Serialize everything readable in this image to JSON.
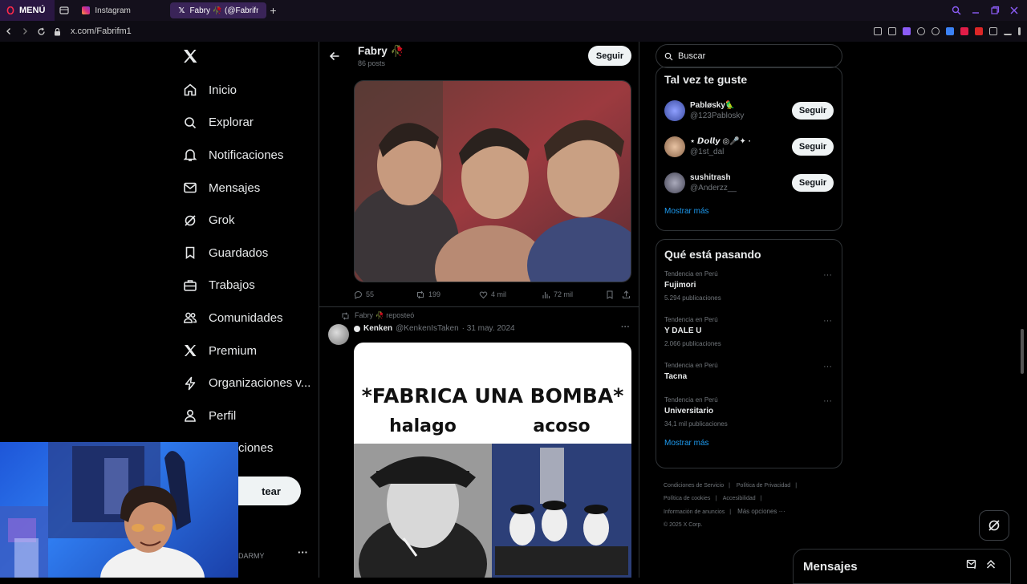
{
  "browser": {
    "menu_label": "MENÚ",
    "tabs": [
      {
        "label": "Instagram",
        "active": false
      },
      {
        "label": "Fabry 🥀 (@Fabrifm1) / X",
        "active": true
      }
    ],
    "url": "x.com/Fabrifm1"
  },
  "nav": {
    "items": [
      {
        "label": "Inicio",
        "icon": "home-icon"
      },
      {
        "label": "Explorar",
        "icon": "search-icon"
      },
      {
        "label": "Notificaciones",
        "icon": "bell-icon"
      },
      {
        "label": "Mensajes",
        "icon": "mail-icon"
      },
      {
        "label": "Grok",
        "icon": "grok-icon"
      },
      {
        "label": "Guardados",
        "icon": "bookmark-icon"
      },
      {
        "label": "Trabajos",
        "icon": "briefcase-icon"
      },
      {
        "label": "Comunidades",
        "icon": "people-icon"
      },
      {
        "label": "Premium",
        "icon": "x-logo-icon"
      },
      {
        "label": "Organizaciones v...",
        "icon": "lightning-icon"
      },
      {
        "label": "Perfil",
        "icon": "person-icon"
      },
      {
        "label": "ciones",
        "icon": "more-icon"
      }
    ],
    "post_label": "tear",
    "account_tail": "DARMY"
  },
  "profile_header": {
    "name": "Fabry 🥀",
    "posts": "86 posts",
    "follow_label": "Seguir"
  },
  "tweet1": {
    "metrics": {
      "replies": "55",
      "retweets": "199",
      "likes": "4 mil",
      "views": "72 mil"
    }
  },
  "tweet2": {
    "reposted_by": "Fabry 🥀 reposteó",
    "author_name": "Kenken",
    "author_handle": "@KenkenIsTaken",
    "date": "· 31 may. 2024",
    "meme_title": "*FABRICA UNA BOMBA*",
    "meme_left": "halago",
    "meme_right": "acoso"
  },
  "search": {
    "placeholder": "Buscar"
  },
  "suggestions": {
    "title": "Tal vez te guste",
    "users": [
      {
        "name": "Pabløsky🦜",
        "handle": "@123Pablosky",
        "button": "Seguir",
        "avatar_color": "#5b6db5"
      },
      {
        "name": "⋆ 𝘿𝙤𝙡𝙡𝙮 ◎🎤✦ ·",
        "handle": "@1st_dal",
        "button": "Seguir",
        "avatar_color": "#b08a6a"
      },
      {
        "name": "sushitrash",
        "handle": "@Anderzz__",
        "button": "Seguir",
        "avatar_color": "#555a66"
      }
    ],
    "more": "Mostrar más"
  },
  "trends": {
    "title": "Qué está pasando",
    "items": [
      {
        "context": "Tendencia en Perú",
        "name": "Fujimori",
        "count": "5.294 publicaciones"
      },
      {
        "context": "Tendencia en Perú",
        "name": "Y DALE U",
        "count": "2.066 publicaciones"
      },
      {
        "context": "Tendencia en Perú",
        "name": "Tacna",
        "count": ""
      },
      {
        "context": "Tendencia en Perú",
        "name": "Universitario",
        "count": "34,1 mil publicaciones"
      }
    ],
    "more": "Mostrar más"
  },
  "footer": {
    "links": [
      "Condiciones de Servicio",
      "|",
      "Política de Privacidad",
      "|",
      "Política de cookies",
      "|",
      "Accesibilidad",
      "|",
      "Información de anuncios",
      "|",
      "Más opciones ···"
    ],
    "copyright": "© 2025 X Corp."
  },
  "messages": {
    "label": "Mensajes"
  },
  "colors": {
    "accent": "#1d9bf0",
    "background": "#000000",
    "border": "#2f3336"
  }
}
